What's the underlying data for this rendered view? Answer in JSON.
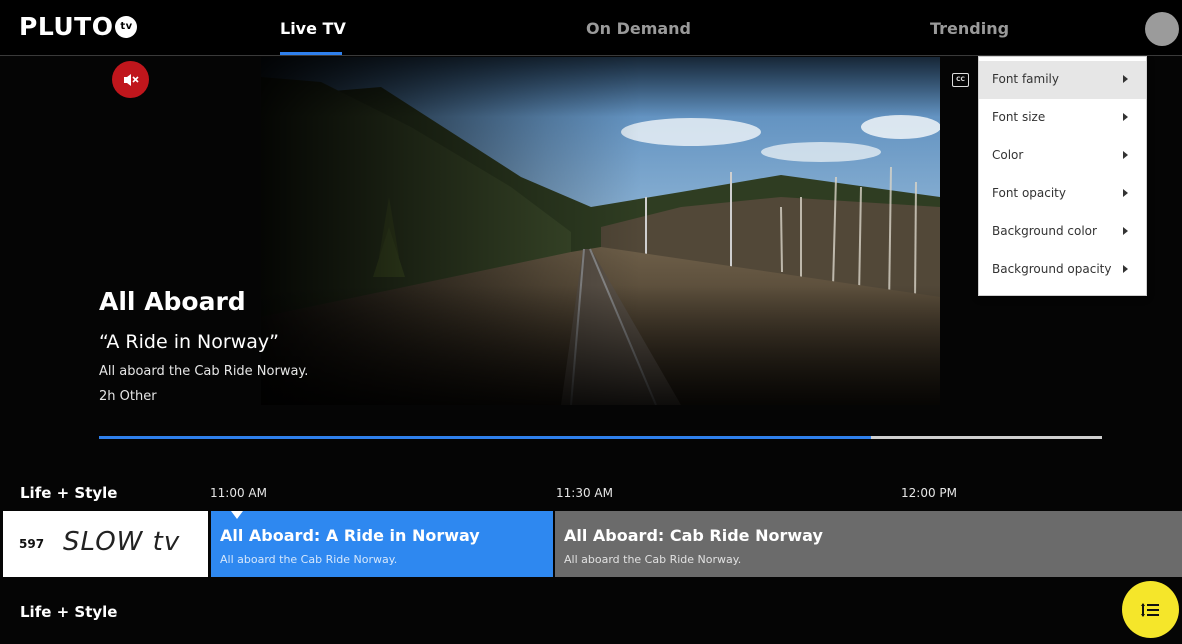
{
  "header": {
    "logo_text": "PLUTO",
    "logo_badge": "tv",
    "tabs": [
      {
        "label": "Live TV",
        "active": true
      },
      {
        "label": "On Demand",
        "active": false
      },
      {
        "label": "Trending",
        "active": false
      }
    ]
  },
  "player": {
    "show_title": "All Aboard",
    "episode_title": "“A Ride in Norway”",
    "description": "All aboard the Cab Ride Norway.",
    "meta": "2h Other",
    "cc_label": "CC",
    "progress_percent": 77
  },
  "caption_menu": {
    "items": [
      {
        "label": "Font family",
        "highlighted": true
      },
      {
        "label": "Font size",
        "highlighted": false
      },
      {
        "label": "Color",
        "highlighted": false
      },
      {
        "label": "Font opacity",
        "highlighted": false
      },
      {
        "label": "Background color",
        "highlighted": false
      },
      {
        "label": "Background opacity",
        "highlighted": false
      }
    ]
  },
  "guide": {
    "category_top": "Life + Style",
    "category_bottom": "Life + Style",
    "times": [
      "11:00 AM",
      "11:30 AM",
      "12:00 PM"
    ],
    "channel": {
      "number": "597",
      "logo_text": "SLOW tv"
    },
    "programs": [
      {
        "title": "All Aboard: A Ride in Norway",
        "description": "All aboard the Cab Ride Norway."
      },
      {
        "title": "All Aboard: Cab Ride Norway",
        "description": "All aboard the Cab Ride Norway."
      }
    ]
  },
  "colors": {
    "accent_blue": "#2e88f0",
    "mute_red": "#c0161c",
    "fab_yellow": "#f5e62a"
  },
  "icons": {
    "mute": "speaker-muted-icon",
    "cc": "closed-captions-icon",
    "fab": "guide-list-icon",
    "avatar": "user-avatar"
  }
}
